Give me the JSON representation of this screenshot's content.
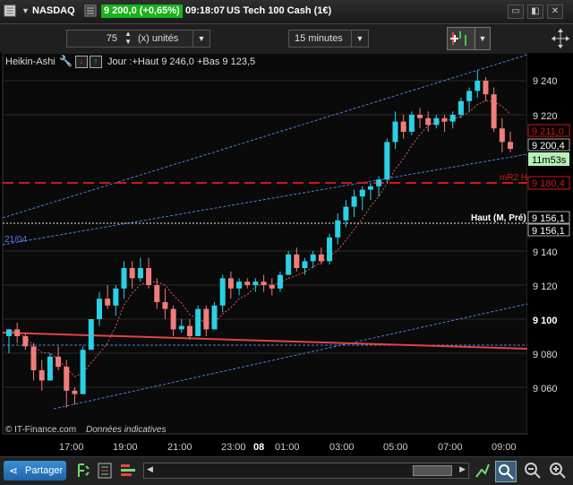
{
  "titlebar": {
    "instrument": "NASDAQ",
    "price_box": "9 200,0 (+0,65%)",
    "time": "09:18:07",
    "name": "US Tech 100 Cash (1€)",
    "win_buttons": [
      "▭",
      "◧",
      "✕"
    ]
  },
  "toolbar": {
    "quantity_value": "75",
    "quantity_unit": "(x) unités",
    "timeframe": "15 minutes"
  },
  "chart_header": {
    "type_label": "Heikin-Ashi",
    "info": "Jour :+Haut 9 246,0 +Bas 9 123,5"
  },
  "price_axis": {
    "labels": [
      "9 240",
      "9 220",
      "9 140",
      "9 120",
      "9 100",
      "9 080",
      "9 060"
    ],
    "bold_label": "9 100",
    "markers": [
      "9 211,0",
      "9 200,4",
      "9 180,4",
      "9 156,1",
      "9 156,1"
    ],
    "countdown": "11m53s"
  },
  "time_axis": {
    "labels": [
      "17:00",
      "19:00",
      "21:00",
      "23:00",
      "08",
      "01:00",
      "03:00",
      "05:00",
      "07:00",
      "09:00"
    ]
  },
  "annotations": {
    "channel_date": "21/04",
    "mr2_label": "mR2 H",
    "haut_label": "Haut (M, Pré)",
    "copyright": "© IT-Finance.com",
    "disclaimer": "Données indicatives"
  },
  "bottombar": {
    "share_label": "Partager"
  },
  "colors": {
    "up": "#2ad1e6",
    "down": "#f07c7c",
    "price_green": "#17b317",
    "mr2_red": "#d01818"
  },
  "candles": [
    [
      9090,
      9094,
      9080,
      9094
    ],
    [
      9094,
      9098,
      9086,
      9090
    ],
    [
      9090,
      9092,
      9082,
      9084
    ],
    [
      9084,
      9086,
      9064,
      9070
    ],
    [
      9070,
      9076,
      9058,
      9064
    ],
    [
      9064,
      9080,
      9064,
      9078
    ],
    [
      9078,
      9084,
      9070,
      9072
    ],
    [
      9072,
      9076,
      9048,
      9058
    ],
    [
      9058,
      9060,
      9050,
      9056
    ],
    [
      9056,
      9084,
      9056,
      9082
    ],
    [
      9082,
      9100,
      9082,
      9100
    ],
    [
      9100,
      9116,
      9096,
      9112
    ],
    [
      9112,
      9120,
      9106,
      9108
    ],
    [
      9108,
      9120,
      9102,
      9118
    ],
    [
      9118,
      9134,
      9112,
      9130
    ],
    [
      9130,
      9134,
      9118,
      9124
    ],
    [
      9124,
      9136,
      9122,
      9130
    ],
    [
      9130,
      9136,
      9118,
      9120
    ],
    [
      9120,
      9124,
      9106,
      9110
    ],
    [
      9110,
      9118,
      9100,
      9106
    ],
    [
      9106,
      9108,
      9090,
      9094
    ],
    [
      9094,
      9100,
      9092,
      9096
    ],
    [
      9096,
      9100,
      9088,
      9090
    ],
    [
      9090,
      9108,
      9090,
      9106
    ],
    [
      9106,
      9108,
      9090,
      9094
    ],
    [
      9094,
      9110,
      9094,
      9108
    ],
    [
      9108,
      9126,
      9104,
      9124
    ],
    [
      9124,
      9128,
      9112,
      9118
    ],
    [
      9118,
      9124,
      9114,
      9122
    ],
    [
      9122,
      9124,
      9118,
      9120
    ],
    [
      9120,
      9124,
      9116,
      9122
    ],
    [
      9122,
      9126,
      9116,
      9120
    ],
    [
      9120,
      9124,
      9114,
      9118
    ],
    [
      9118,
      9128,
      9116,
      9126
    ],
    [
      9126,
      9140,
      9126,
      9138
    ],
    [
      9138,
      9142,
      9128,
      9130
    ],
    [
      9130,
      9136,
      9126,
      9134
    ],
    [
      9134,
      9140,
      9130,
      9138
    ],
    [
      9138,
      9142,
      9132,
      9134
    ],
    [
      9134,
      9150,
      9132,
      9148
    ],
    [
      9148,
      9162,
      9144,
      9158
    ],
    [
      9158,
      9170,
      9154,
      9166
    ],
    [
      9166,
      9176,
      9160,
      9172
    ],
    [
      9172,
      9178,
      9164,
      9176
    ],
    [
      9176,
      9180,
      9170,
      9178
    ],
    [
      9178,
      9184,
      9172,
      9182
    ],
    [
      9182,
      9206,
      9180,
      9204
    ],
    [
      9204,
      9222,
      9200,
      9216
    ],
    [
      9216,
      9220,
      9206,
      9210
    ],
    [
      9210,
      9222,
      9208,
      9220
    ],
    [
      9220,
      9224,
      9212,
      9218
    ],
    [
      9218,
      9222,
      9210,
      9214
    ],
    [
      9214,
      9220,
      9212,
      9218
    ],
    [
      9218,
      9220,
      9210,
      9216
    ],
    [
      9216,
      9222,
      9212,
      9220
    ],
    [
      9220,
      9230,
      9218,
      9228
    ],
    [
      9228,
      9236,
      9222,
      9234
    ],
    [
      9234,
      9246,
      9230,
      9240
    ],
    [
      9240,
      9242,
      9228,
      9232
    ],
    [
      9232,
      9236,
      9210,
      9212
    ],
    [
      9212,
      9218,
      9198,
      9204
    ],
    [
      9204,
      9210,
      9198,
      9200
    ]
  ]
}
